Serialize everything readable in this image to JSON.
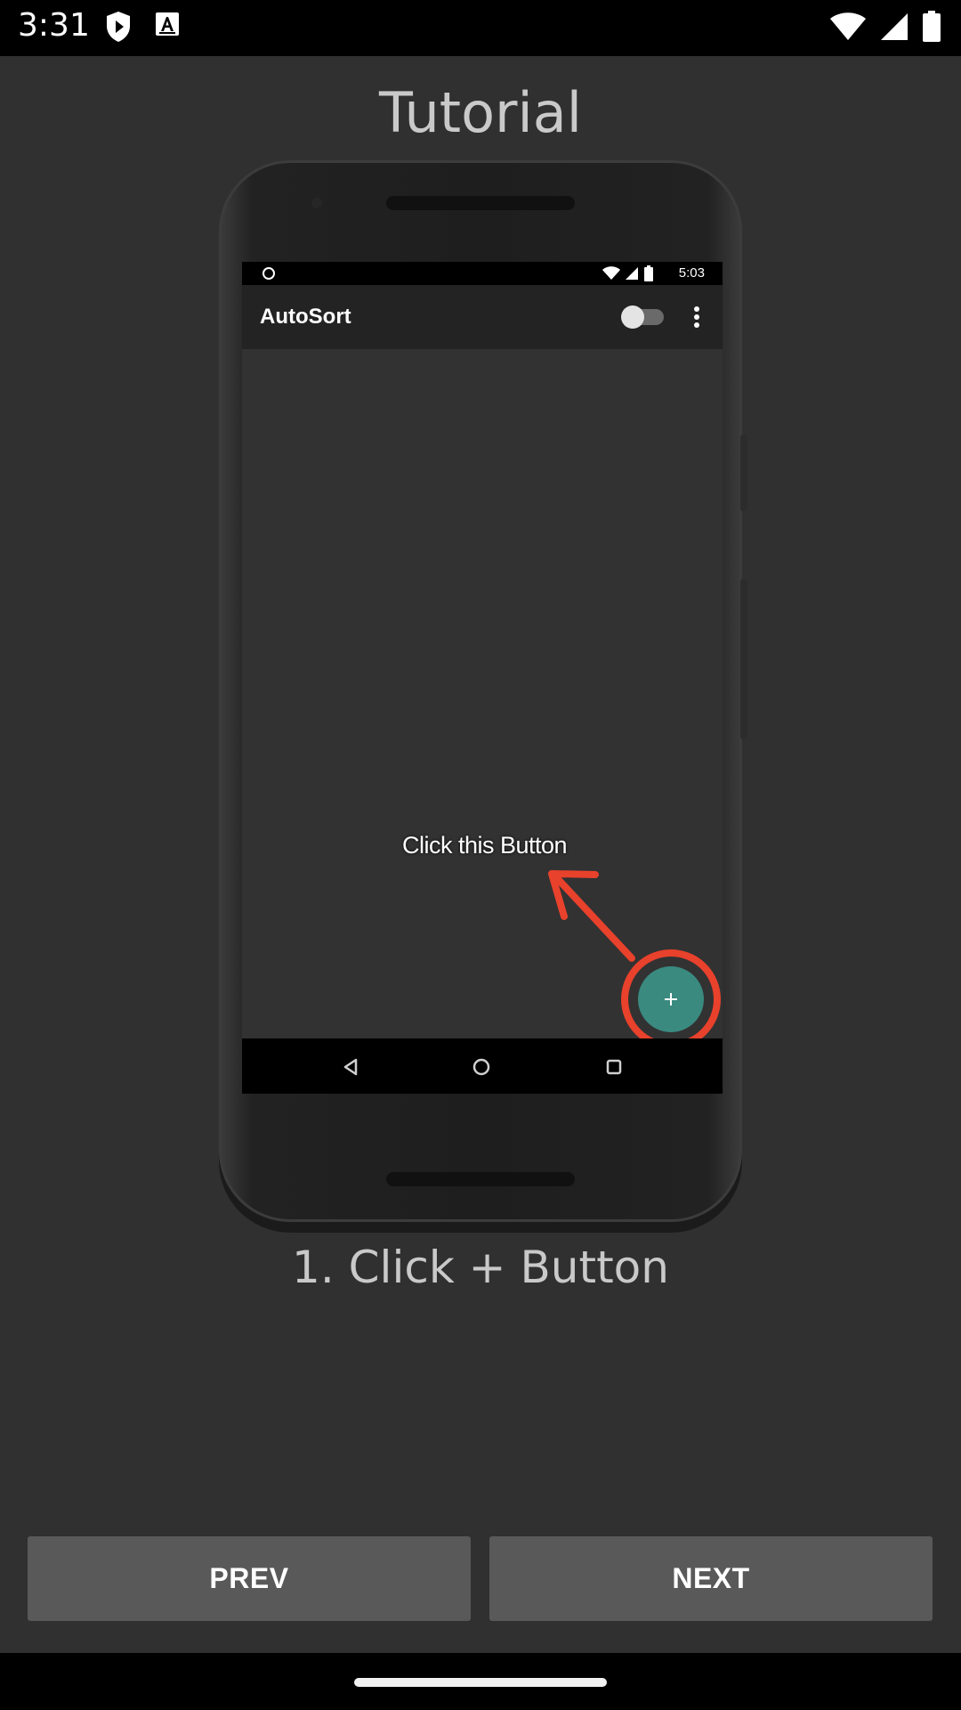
{
  "status_bar": {
    "time": "3:31",
    "left_icons": [
      "shield-play-icon",
      "text-a-icon"
    ],
    "right_icons": [
      "wifi-icon",
      "cell-signal-icon",
      "battery-icon"
    ]
  },
  "page": {
    "title": "Tutorial"
  },
  "illustration": {
    "status_time": "5:03",
    "app_title": "AutoSort",
    "hint_text": "Click this Button",
    "fab_label": "+",
    "colors": {
      "fab": "#3a8a80",
      "annotation": "#e8412c"
    }
  },
  "step": {
    "caption": "1. Click + Button"
  },
  "buttons": {
    "prev_label": "PREV",
    "next_label": "NEXT"
  },
  "colors": {
    "background": "#303030",
    "button": "#595959",
    "title_text": "#c9c9c9"
  }
}
